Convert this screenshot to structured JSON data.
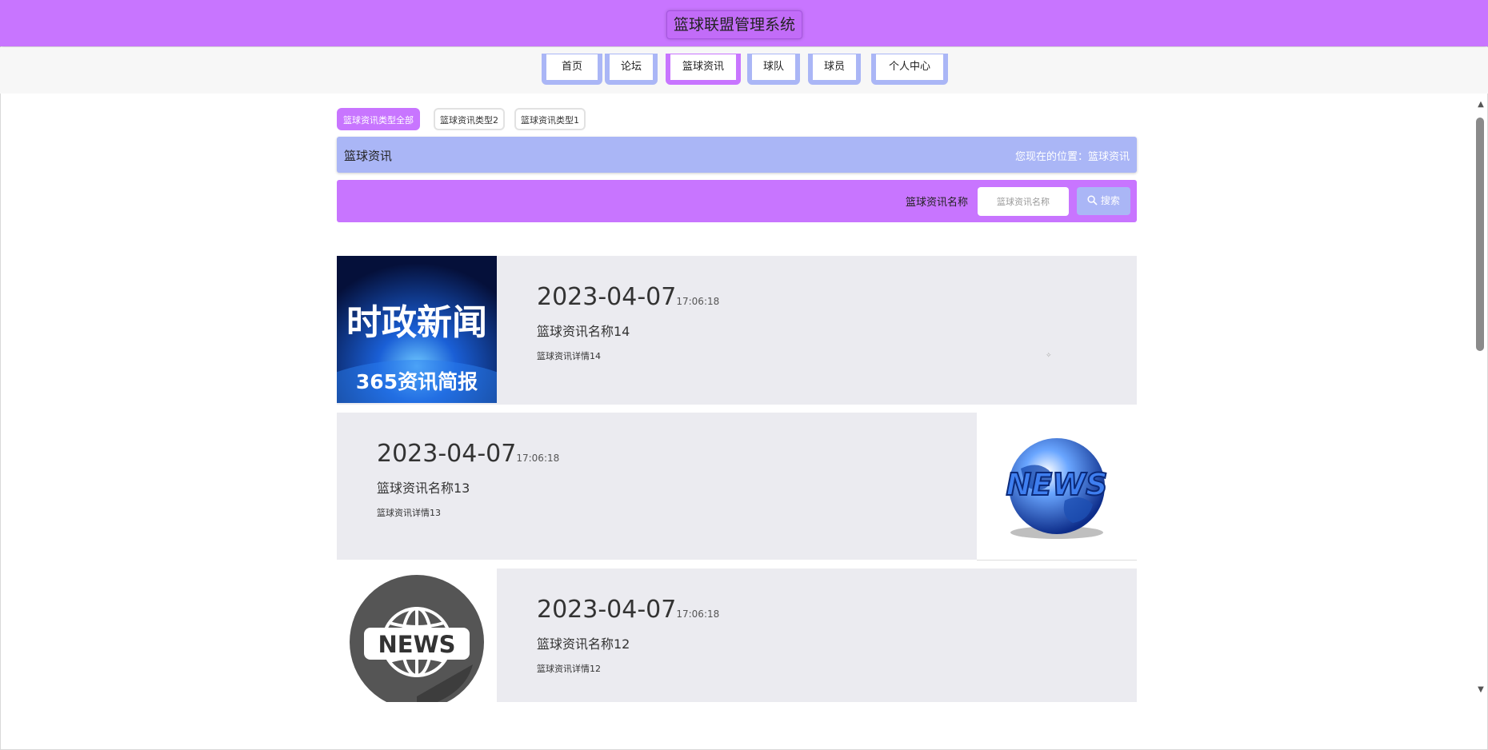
{
  "header": {
    "title": "篮球联盟管理系统"
  },
  "nav": {
    "items": [
      {
        "label": "首页"
      },
      {
        "label": "论坛"
      },
      {
        "label": "篮球资讯"
      },
      {
        "label": "球队"
      },
      {
        "label": "球员"
      },
      {
        "label": "个人中心"
      }
    ],
    "active": "篮球资讯"
  },
  "filters": {
    "tabs": [
      {
        "label": "篮球资讯类型全部"
      },
      {
        "label": "篮球资讯类型2"
      },
      {
        "label": "篮球资讯类型1"
      }
    ],
    "active": "篮球资讯类型全部"
  },
  "title_bar": {
    "title": "篮球资讯",
    "location": "您现在的位置：篮球资讯"
  },
  "search": {
    "label": "篮球资讯名称",
    "placeholder": "篮球资讯名称",
    "button_label": "搜索",
    "button_icon": "search-icon"
  },
  "news": [
    {
      "date": "2023-04-07",
      "time": "17:06:18",
      "name": "篮球资讯名称14",
      "detail": "篮球资讯详情14",
      "image_text_top": "时政新闻",
      "image_text_bottom": "365资讯简报"
    },
    {
      "date": "2023-04-07",
      "time": "17:06:18",
      "name": "篮球资讯名称13",
      "detail": "篮球资讯详情13",
      "image_text": "NEWS"
    },
    {
      "date": "2023-04-07",
      "time": "17:06:18",
      "name": "篮球资讯名称12",
      "detail": "篮球资讯详情12",
      "image_text": "NEWS"
    }
  ],
  "colors": {
    "primary": "#c875ff",
    "secondary": "#aab6f6",
    "card_bg": "#ebebf0"
  }
}
